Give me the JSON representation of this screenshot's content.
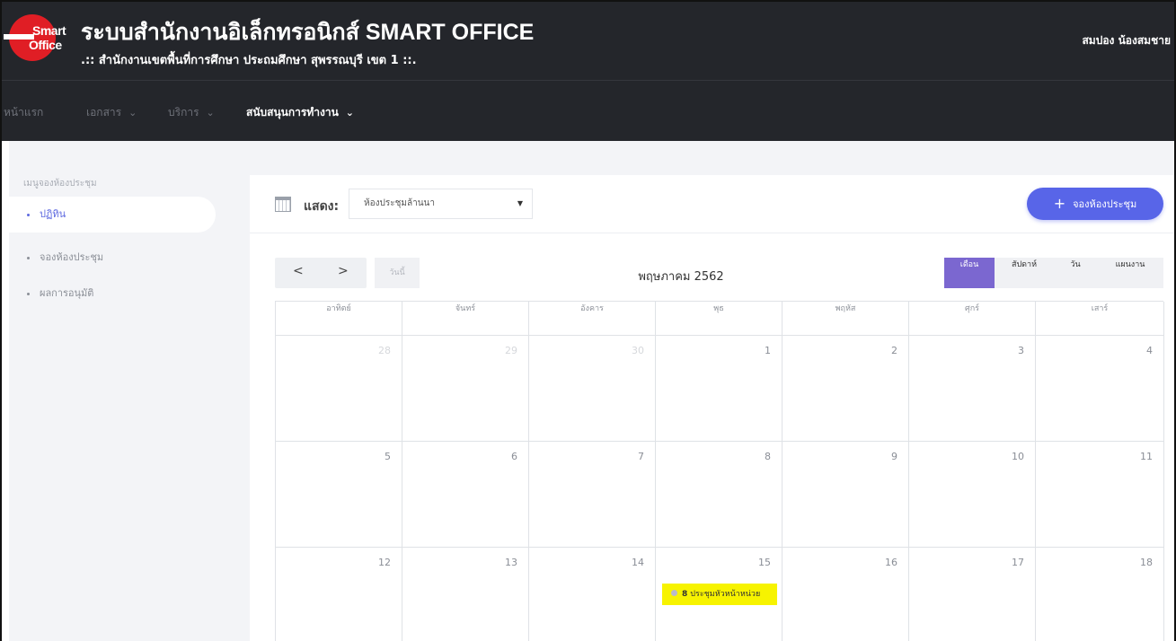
{
  "header": {
    "logo_text_1": "Smart",
    "logo_text_2": "Office",
    "title": "ระบบสำนักงานอิเล็กทรอนิกส์ SMART OFFICE",
    "subtitle": ".:: สำนักงานเขตพื้นที่การศึกษา ประถมศึกษา สุพรรณบุรี เขต 1 ::.",
    "user_name": "สมปอง น้องสมชาย"
  },
  "nav": {
    "items": [
      {
        "label": "หน้าแรก"
      },
      {
        "label": "เอกสาร"
      },
      {
        "label": "บริการ"
      },
      {
        "label": "สนับสนุนการทำงาน"
      }
    ]
  },
  "sidebar": {
    "heading": "เมนูจองห้องประชุม",
    "items": [
      {
        "label": "ปฏิทิน"
      },
      {
        "label": "จองห้องประชุม"
      },
      {
        "label": "ผลการอนุมัติ"
      }
    ]
  },
  "toolbar": {
    "show_label": "แสดง:",
    "room_selected": "ห้องประชุมล้านนา",
    "book_button": "จองห้องประชุม"
  },
  "calendar": {
    "prev": "<",
    "next": ">",
    "today": "วันนี้",
    "month_title": "พฤษภาคม 2562",
    "views": [
      "เดือน",
      "สัปดาห์",
      "วัน",
      "แผนงาน"
    ],
    "active_view": "เดือน",
    "weekdays": [
      "อาทิตย์",
      "จันทร์",
      "อังคาร",
      "พุธ",
      "พฤหัส",
      "ศุกร์",
      "เสาร์"
    ],
    "weeks": [
      [
        {
          "d": "28",
          "m": true
        },
        {
          "d": "29",
          "m": true
        },
        {
          "d": "30",
          "m": true
        },
        {
          "d": "1"
        },
        {
          "d": "2"
        },
        {
          "d": "3"
        },
        {
          "d": "4"
        }
      ],
      [
        {
          "d": "5"
        },
        {
          "d": "6"
        },
        {
          "d": "7"
        },
        {
          "d": "8"
        },
        {
          "d": "9"
        },
        {
          "d": "10"
        },
        {
          "d": "11"
        }
      ],
      [
        {
          "d": "12"
        },
        {
          "d": "13"
        },
        {
          "d": "14"
        },
        {
          "d": "15"
        },
        {
          "d": "16"
        },
        {
          "d": "17"
        },
        {
          "d": "18"
        }
      ]
    ],
    "event": {
      "day": "15",
      "time": "8",
      "title": "ประชุมหัวหน้าหน่วย"
    }
  },
  "colors": {
    "accent": "#5865e8",
    "active_view": "#7b67d0",
    "event": "#f7f300",
    "header": "#24262b"
  }
}
